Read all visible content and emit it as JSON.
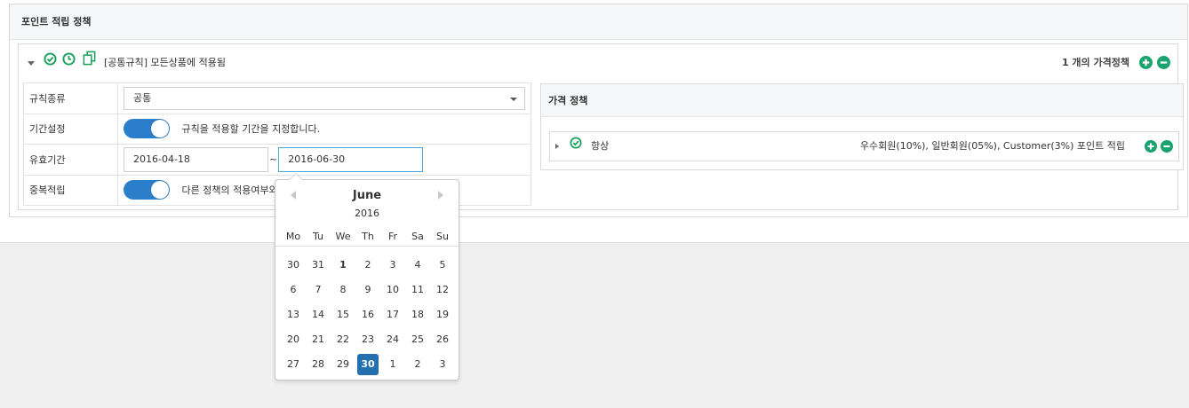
{
  "panel": {
    "title": "포인트 적립 정책"
  },
  "rule": {
    "title": "[공통규칙] 모든상품에 적용됨",
    "count": "1 개의 가격정책"
  },
  "form": {
    "rule_type_label": "규칙종류",
    "rule_type_value": "공통",
    "period_label": "기간설정",
    "period_text": "규칙을 적용할 기간을 지정합니다.",
    "valid_label": "유효기간",
    "start_date": "2016-04-18",
    "separator": "~",
    "end_date": "2016-06-30",
    "dup_label": "중복적립",
    "dup_text": "다른 정책의 적용여부와"
  },
  "price": {
    "title": "가격 정책",
    "row_label": "항상",
    "row_desc": "우수회원(10%), 일반회원(05%), Customer(3%) 포인트 적립"
  },
  "datepicker": {
    "month": "June",
    "year": "2016",
    "weekdays": [
      "Mo",
      "Tu",
      "We",
      "Th",
      "Fr",
      "Sa",
      "Su"
    ],
    "days": [
      "30",
      "31",
      "1",
      "2",
      "3",
      "4",
      "5",
      "6",
      "7",
      "8",
      "9",
      "10",
      "11",
      "12",
      "13",
      "14",
      "15",
      "16",
      "17",
      "18",
      "19",
      "20",
      "21",
      "22",
      "23",
      "24",
      "25",
      "26",
      "27",
      "28",
      "29",
      "30",
      "1",
      "2",
      "3"
    ],
    "selected_index": 31,
    "bold_index": 2
  },
  "colors": {
    "accent_green": "#1aa05a",
    "toggle_blue": "#2b7ec9",
    "selected_blue": "#2470ae",
    "round_btn_green": "#1aa36f"
  }
}
